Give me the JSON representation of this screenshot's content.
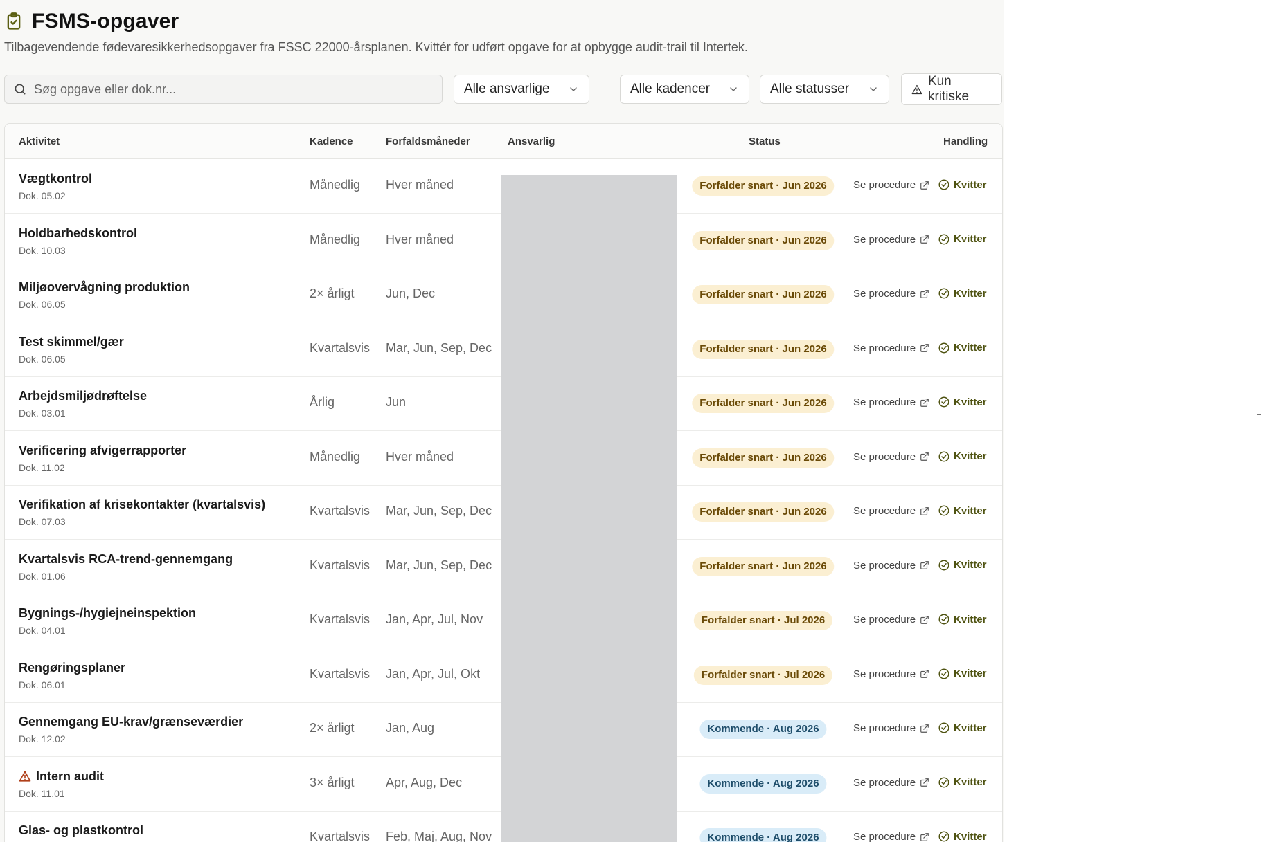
{
  "page": {
    "title": "FSMS-opgaver",
    "icon": "clipboard-check-icon",
    "subtitle": "Tilbagevendende fødevaresikkerhedsopgaver fra FSSC 22000-årsplanen. Kvittér for udført opgave for at opbygge audit-trail til Intertek."
  },
  "filters": {
    "search_placeholder": "Søg opgave eller dok.nr...",
    "responsible": "Alle ansvarlige",
    "cadence": "Alle kadencer",
    "status": "Alle statusser",
    "critical_toggle": "Kun kritiske"
  },
  "table": {
    "headers": {
      "activity": "Aktivitet",
      "cadence": "Kadence",
      "months": "Forfaldsmåneder",
      "responsible": "Ansvarlig",
      "status": "Status",
      "action": "Handling"
    },
    "action_procedure": "Se procedure",
    "action_ack": "Kvitter",
    "rows": [
      {
        "name": "Vægtkontrol",
        "doc": "Dok. 05.02",
        "cadence": "Månedlig",
        "months": "Hver måned",
        "status": "Forfalder snart · Jun 2026",
        "status_kind": "warn",
        "critical": false
      },
      {
        "name": "Holdbarhedskontrol",
        "doc": "Dok. 10.03",
        "cadence": "Månedlig",
        "months": "Hver måned",
        "status": "Forfalder snart · Jun 2026",
        "status_kind": "warn",
        "critical": false
      },
      {
        "name": "Miljøovervågning produktion",
        "doc": "Dok. 06.05",
        "cadence": "2× årligt",
        "months": "Jun, Dec",
        "status": "Forfalder snart · Jun 2026",
        "status_kind": "warn",
        "critical": false
      },
      {
        "name": "Test skimmel/gær",
        "doc": "Dok. 06.05",
        "cadence": "Kvartalsvis",
        "months": "Mar, Jun, Sep, Dec",
        "status": "Forfalder snart · Jun 2026",
        "status_kind": "warn",
        "critical": false
      },
      {
        "name": "Arbejdsmiljødrøftelse",
        "doc": "Dok. 03.01",
        "cadence": "Årlig",
        "months": "Jun",
        "status": "Forfalder snart · Jun 2026",
        "status_kind": "warn",
        "critical": false
      },
      {
        "name": "Verificering afvigerrapporter",
        "doc": "Dok. 11.02",
        "cadence": "Månedlig",
        "months": "Hver måned",
        "status": "Forfalder snart · Jun 2026",
        "status_kind": "warn",
        "critical": false
      },
      {
        "name": "Verifikation af krisekontakter (kvartalsvis)",
        "doc": "Dok. 07.03",
        "cadence": "Kvartalsvis",
        "months": "Mar, Jun, Sep, Dec",
        "status": "Forfalder snart · Jun 2026",
        "status_kind": "warn",
        "critical": false
      },
      {
        "name": "Kvartalsvis RCA-trend-gennemgang",
        "doc": "Dok. 01.06",
        "cadence": "Kvartalsvis",
        "months": "Mar, Jun, Sep, Dec",
        "status": "Forfalder snart · Jun 2026",
        "status_kind": "warn",
        "critical": false
      },
      {
        "name": "Bygnings-/hygiejneinspektion",
        "doc": "Dok. 04.01",
        "cadence": "Kvartalsvis",
        "months": "Jan, Apr, Jul, Nov",
        "status": "Forfalder snart · Jul 2026",
        "status_kind": "warn",
        "critical": false
      },
      {
        "name": "Rengøringsplaner",
        "doc": "Dok. 06.01",
        "cadence": "Kvartalsvis",
        "months": "Jan, Apr, Jul, Okt",
        "status": "Forfalder snart · Jul 2026",
        "status_kind": "warn",
        "critical": false
      },
      {
        "name": "Gennemgang EU-krav/grænseværdier",
        "doc": "Dok. 12.02",
        "cadence": "2× årligt",
        "months": "Jan, Aug",
        "status": "Kommende · Aug 2026",
        "status_kind": "info",
        "critical": false
      },
      {
        "name": "Intern audit",
        "doc": "Dok. 11.01",
        "cadence": "3× årligt",
        "months": "Apr, Aug, Dec",
        "status": "Kommende · Aug 2026",
        "status_kind": "info",
        "critical": true
      },
      {
        "name": "Glas- og plastkontrol",
        "doc": "",
        "cadence": "Kvartalsvis",
        "months": "Feb, Maj, Aug, Nov",
        "status": "Kommende · Aug 2026",
        "status_kind": "info",
        "critical": false
      }
    ]
  }
}
